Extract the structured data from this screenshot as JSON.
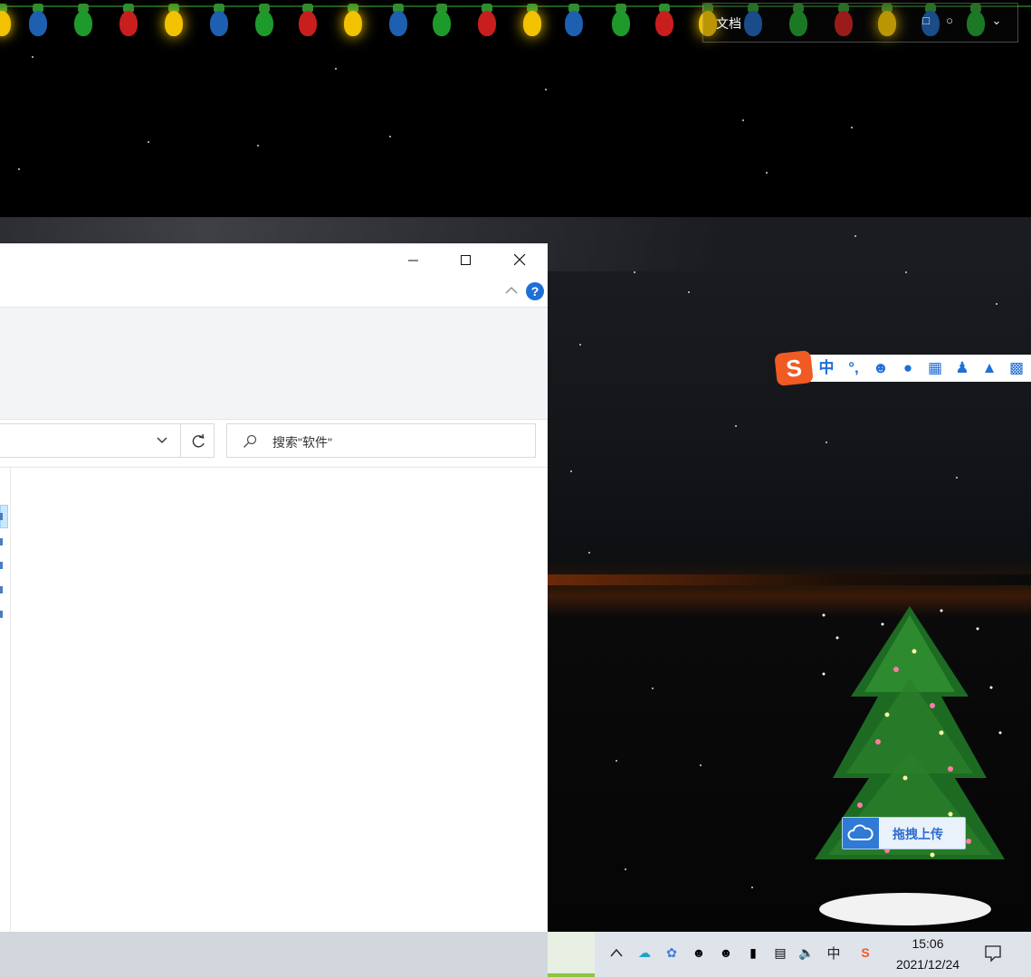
{
  "desktop": {
    "doc_bar": {
      "label": "文档"
    }
  },
  "explorer": {
    "search": {
      "placeholder": "搜索\"软件\""
    },
    "help_label": "?"
  },
  "ime": {
    "mode_label": "中",
    "punct_label": "°,"
  },
  "upload": {
    "label": "拖拽上传"
  },
  "taskbar": {
    "ime_indicator": "中",
    "clock": {
      "time": "15:06",
      "date": "2021/12/24"
    }
  },
  "colors": {
    "accent": "#1e6fd6",
    "sogou": "#f05a23",
    "taskbar": "#dfe3ea"
  }
}
